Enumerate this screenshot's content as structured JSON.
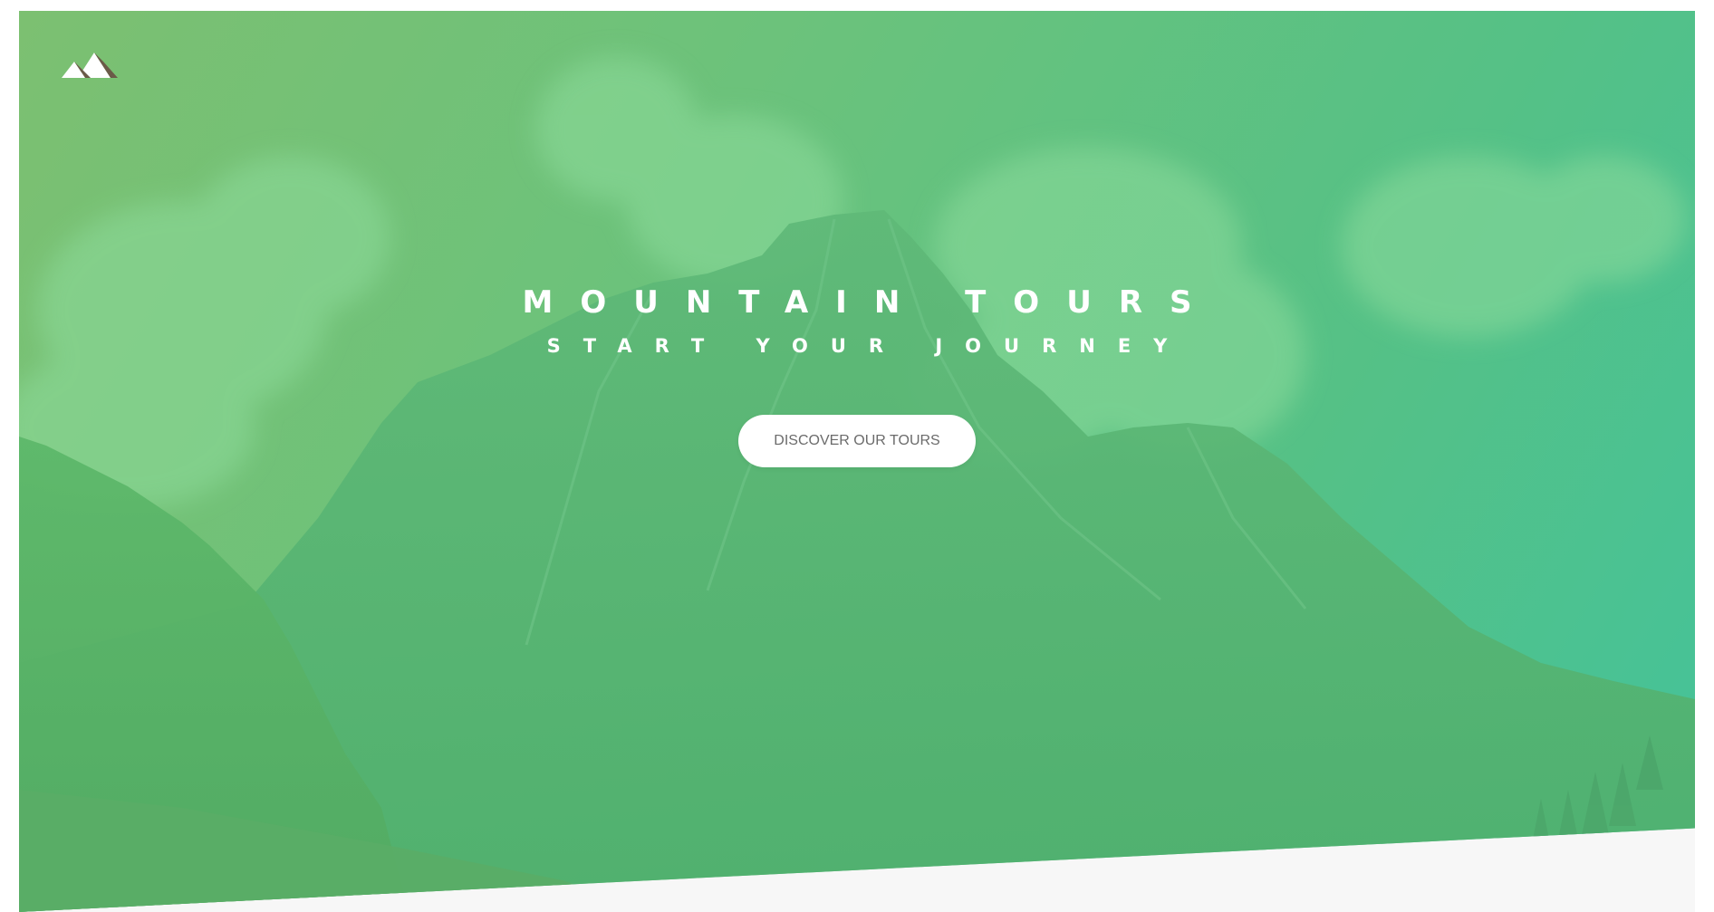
{
  "header": {
    "logo_icon": "mountain-logo-icon"
  },
  "hero": {
    "title": "MOUNTAIN TOURS",
    "subtitle": "START YOUR JOURNEY",
    "cta_label": "DISCOVER OUR TOURS"
  },
  "colors": {
    "gradient_start": "#7cc071",
    "gradient_end": "#44c29a",
    "cta_background": "#ffffff",
    "cta_text": "#6b6b6b",
    "heading_text": "#ffffff",
    "page_background": "#f7f7f7"
  }
}
